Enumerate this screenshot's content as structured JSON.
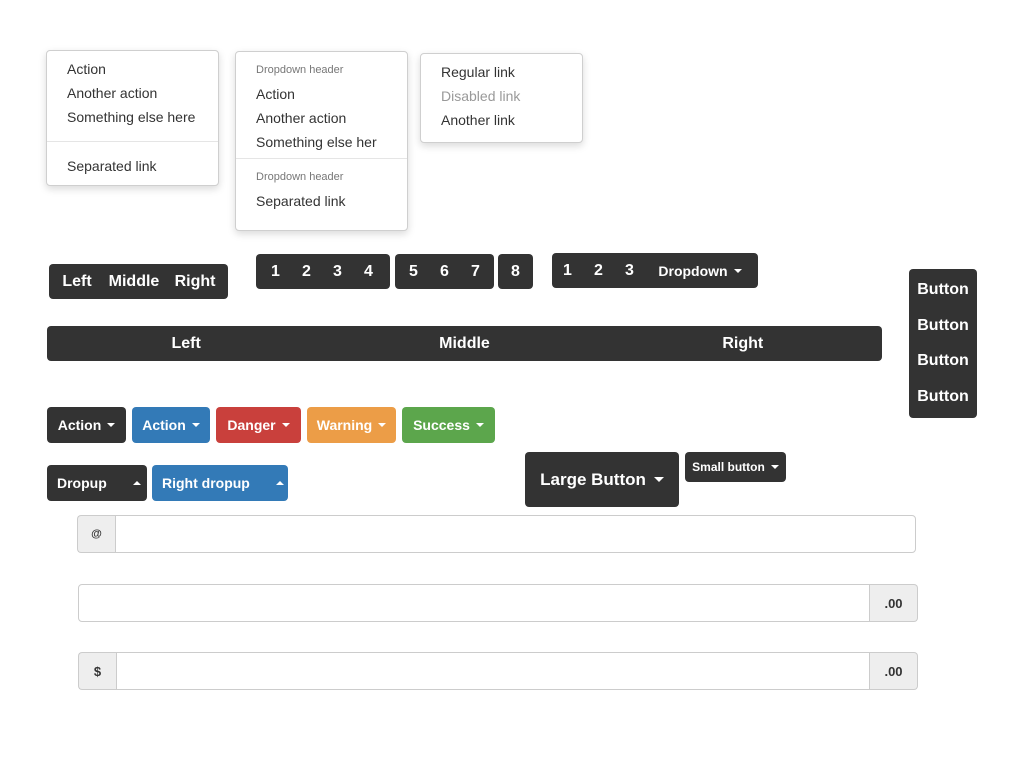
{
  "colors": {
    "dark": "#333333",
    "primary": "#337ab7",
    "danger": "#c9403c",
    "warning": "#ec9d47",
    "success": "#5ca64c"
  },
  "menu1": {
    "items": [
      "Action",
      "Another action",
      "Something else here"
    ],
    "separated": "Separated link"
  },
  "menu2": {
    "header1": "Dropdown header",
    "items": [
      "Action",
      "Another action",
      "Something else her"
    ],
    "header2": "Dropdown header",
    "separated": "Separated link"
  },
  "menu3": {
    "regular": "Regular link",
    "disabled": "Disabled link",
    "another": "Another link"
  },
  "group_lmr": [
    "Left",
    "Middle",
    "Right"
  ],
  "pager": {
    "group1": [
      "1",
      "2",
      "3",
      "4"
    ],
    "group2": [
      "5",
      "6",
      "7"
    ],
    "group3": [
      "8"
    ]
  },
  "pager_dropdown": {
    "numbers": [
      "1",
      "2",
      "3"
    ],
    "dropdown": "Dropdown"
  },
  "justified": [
    "Left",
    "Middle",
    "Right"
  ],
  "vertical": [
    "Button",
    "Button",
    "Button",
    "Button"
  ],
  "split_buttons": {
    "dark": "Action",
    "primary": "Action",
    "danger": "Danger",
    "warning": "Warning",
    "success": "Success"
  },
  "dropup": {
    "dark": "Dropup",
    "primary": "Right dropup"
  },
  "sizes": {
    "large": "Large Button",
    "small": "Small button"
  },
  "inputs": {
    "at_addon": "@",
    "cents_addon": ".00",
    "dollar_addon": "$",
    "cents_addon2": ".00"
  }
}
